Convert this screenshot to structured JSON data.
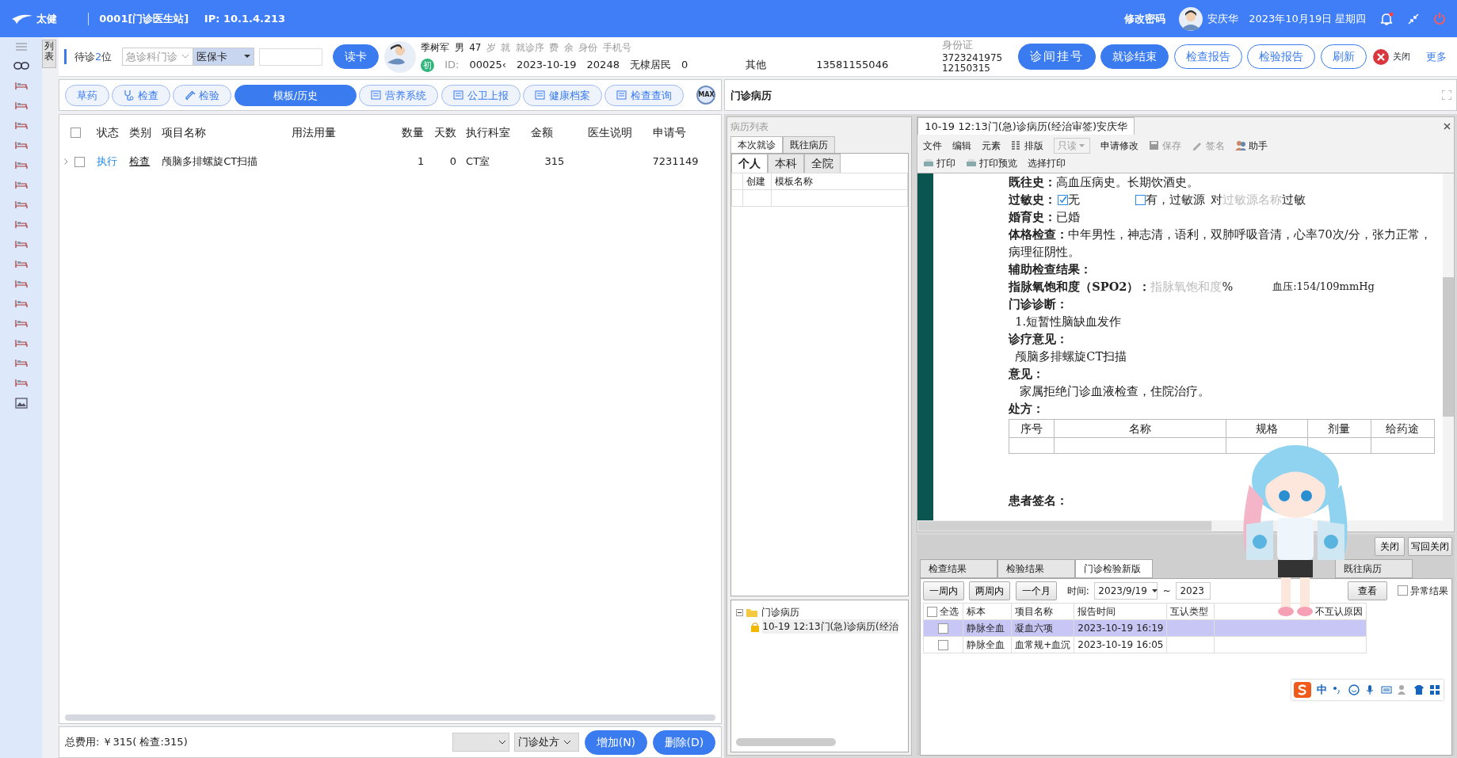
{
  "header": {
    "logo_text": "太健",
    "title": "0001[门诊医生站]",
    "ip": "IP: 10.1.4.213",
    "change_password": "修改密码",
    "user": "安庆华",
    "date": "2023年10月19日 星期四"
  },
  "side_tab": "列表",
  "queue": {
    "prefix": "待诊",
    "count": "2",
    "suffix": "位"
  },
  "dept_select": "急诊科门诊",
  "card_type": "医保卡",
  "read_card_button": "读卡",
  "patient": {
    "line1": [
      {
        "text": "季树军",
        "kind": "value"
      },
      {
        "text": "男",
        "kind": "value"
      },
      {
        "text": "47",
        "kind": "value"
      },
      {
        "text": "岁",
        "kind": "label"
      },
      {
        "text": "就",
        "kind": "label"
      },
      {
        "text": "就诊序",
        "kind": "label"
      },
      {
        "text": "费",
        "kind": "label"
      },
      {
        "text": "余",
        "kind": "label"
      },
      {
        "text": "身份",
        "kind": "label"
      },
      {
        "text": "手机号",
        "kind": "label"
      }
    ],
    "first_visit": "初",
    "line2": [
      {
        "text": "ID:",
        "kind": "label"
      },
      {
        "text": "00025‹",
        "kind": "value"
      },
      {
        "text": "2023-10-19",
        "kind": "value"
      },
      {
        "text": "20248",
        "kind": "value"
      },
      {
        "text": "无棣居民",
        "kind": "value"
      },
      {
        "text": "0",
        "kind": "value"
      },
      {
        "text": "其他",
        "kind": "value"
      },
      {
        "text": "13581155046",
        "kind": "value"
      }
    ],
    "id_card_label": "身份证",
    "id_card_lines": [
      "3723241975",
      "12150315"
    ]
  },
  "actions": [
    {
      "label": "诊间挂号",
      "kind": "primary"
    },
    {
      "label": "就诊结束",
      "kind": "primary"
    },
    {
      "label": "检查报告",
      "kind": "outline"
    },
    {
      "label": "检验报告",
      "kind": "outline"
    },
    {
      "label": "刷新",
      "kind": "outline"
    }
  ],
  "close_button": "关闭",
  "more_link": "更多",
  "toolbar_tabs": [
    {
      "label": "草药",
      "kind": "plain",
      "selected": false
    },
    {
      "label": "检查",
      "kind": "stethoscope",
      "selected": false
    },
    {
      "label": "检验",
      "kind": "tube",
      "selected": false
    },
    {
      "label": "模板/历史",
      "kind": "plain",
      "selected": true
    },
    {
      "label": "营养系统",
      "kind": "form",
      "selected": false
    },
    {
      "label": "公卫上报",
      "kind": "form",
      "selected": false
    },
    {
      "label": "健康档案",
      "kind": "form",
      "selected": false
    },
    {
      "label": "检查查询",
      "kind": "form",
      "selected": false
    }
  ],
  "max_button": "MAX",
  "orders": {
    "select_all_checked": false,
    "columns": [
      "状态",
      "类别",
      "项目名称",
      "用法用量",
      "数量",
      "天数",
      "执行科室",
      "金额",
      "医生说明",
      "申请号"
    ],
    "rows": [
      {
        "checked": false,
        "cells": [
          "执行",
          "检查",
          "颅脑多排螺旋CT扫描",
          "",
          "1",
          "0",
          "CT室",
          "315",
          "",
          "7231149"
        ]
      }
    ]
  },
  "footer": {
    "total": "总费用: ￥315( 检查:315)",
    "prescription_select": "门诊处方",
    "buttons": [
      "增加(N)",
      "删除(D)"
    ]
  },
  "record_title": "门诊病历",
  "record_list": {
    "title": "病历列表",
    "tabs": [
      {
        "label": "本次就诊",
        "selected": true
      },
      {
        "label": "既往病历",
        "selected": false
      }
    ],
    "scope_tabs": [
      {
        "label": "个人",
        "selected": true
      },
      {
        "label": "本科",
        "selected": false
      },
      {
        "label": "全院",
        "selected": false
      }
    ],
    "columns": [
      "创建",
      "模板名称"
    ],
    "tree": [
      {
        "label": "门诊病历",
        "expanded": true,
        "children": [
          {
            "label": "10-19 12:13门(急)诊病历(经治"
          }
        ]
      }
    ]
  },
  "document": {
    "tab": "10-19 12:13门(急)诊病历(经治审签)安庆华",
    "menu": [
      {
        "label": "文件",
        "kind": "text",
        "disabled": false
      },
      {
        "label": "编辑",
        "kind": "text",
        "disabled": false
      },
      {
        "label": "元素",
        "kind": "text",
        "disabled": false
      },
      {
        "label": "排版",
        "kind": "layout",
        "disabled": false
      },
      {
        "label": "只读",
        "kind": "select",
        "disabled": true
      },
      {
        "label": "申请修改",
        "kind": "text",
        "disabled": false
      },
      {
        "label": "保存",
        "kind": "save",
        "disabled": true
      },
      {
        "label": "签名",
        "kind": "sign",
        "disabled": true
      },
      {
        "label": "助手",
        "kind": "people",
        "disabled": false
      }
    ],
    "menu2": [
      "打印",
      "打印预览",
      "选择打印"
    ],
    "lines": [
      {
        "kind": "field",
        "label": "既往史：",
        "text": "高血压病史。长期饮酒史。"
      },
      {
        "kind": "allergy",
        "label": "过敏史：",
        "options": [
          {
            "label": "无",
            "checked": true
          },
          {
            "label": "有，过敏源",
            "checked": false
          }
        ],
        "before": "对",
        "placeholder": "过敏源名称",
        "after": "过敏"
      },
      {
        "kind": "field",
        "label": "婚育史：",
        "text": "已婚"
      },
      {
        "kind": "field",
        "label": "体格检查：",
        "text": "中年男性，神志清，语利，双肺呼吸音清，心率70次/分，张力正常，病理征阴性。"
      },
      {
        "kind": "heading",
        "label": "辅助检查结果："
      },
      {
        "kind": "spo2",
        "label": "指脉氧饱和度（SPO2）：",
        "placeholder": "指脉氧饱和度",
        "unit": "%",
        "extra": "血压:154/109mmHg"
      },
      {
        "kind": "heading",
        "label": "门诊诊断："
      },
      {
        "kind": "indent",
        "text": "1.短暂性脑缺血发作"
      },
      {
        "kind": "heading",
        "label": "诊疗意见："
      },
      {
        "kind": "indent",
        "text": "颅脑多排螺旋CT扫描"
      },
      {
        "kind": "heading",
        "label": "意见："
      },
      {
        "kind": "indent",
        "text": "家属拒绝门诊血液检查，住院治疗。"
      },
      {
        "kind": "heading",
        "label": "处方："
      },
      {
        "kind": "table",
        "columns": [
          "序号",
          "名称",
          "规格",
          "剂量",
          "给药途"
        ]
      },
      {
        "kind": "signature",
        "label": "患者签名："
      }
    ]
  },
  "lab": {
    "buttons": [
      "关闭",
      "写回关闭"
    ],
    "tabs": [
      {
        "label": "检查结果",
        "selected": false
      },
      {
        "label": "检验结果",
        "selected": false
      },
      {
        "label": "门诊检验新版",
        "selected": true
      },
      {
        "label": "既往病历",
        "selected": false
      }
    ],
    "ranges": [
      "一周内",
      "两周内",
      "一个月"
    ],
    "time_label": "时间:",
    "date_from": "2023/9/19",
    "tilde": "~",
    "date_to": "2023",
    "view_button": "查看",
    "abnormal": {
      "label": "异常结果",
      "checked": false
    },
    "select_all_checked": false,
    "columns": [
      "全选",
      "标本",
      "项目名称",
      "报告时间",
      "互认类型",
      "不互认原因"
    ],
    "rows": [
      {
        "selected": true,
        "checked": false,
        "cells": [
          "",
          "静脉全血",
          "凝血六项",
          "2023-10-19 16:19",
          "",
          ""
        ]
      },
      {
        "selected": false,
        "checked": false,
        "cells": [
          "",
          "静脉全血",
          "血常规+血沉",
          "2023-10-19 16:05",
          "",
          ""
        ]
      }
    ]
  },
  "ime": {
    "text": "中"
  }
}
